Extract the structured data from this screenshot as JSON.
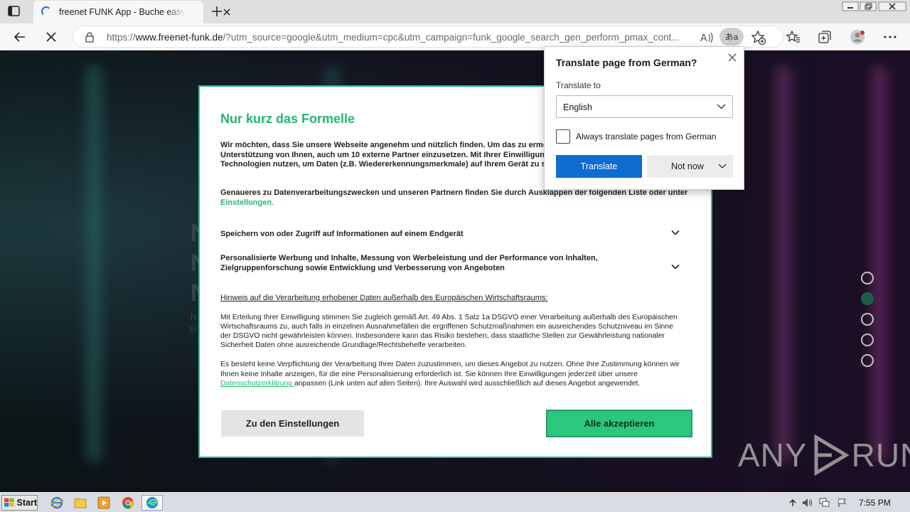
{
  "browser": {
    "tab": {
      "title": "freenet FUNK App - Buche easy und flexibel"
    },
    "url": {
      "prefix": "https://",
      "host": "www.freenet-funk.de",
      "path": "/?utm_source=google&utm_medium=cpc&utm_campaign=funk_google_search_gen_perform_pmax_cont..."
    },
    "translate_icon_text": "あa"
  },
  "consent": {
    "title": "Nur kurz das Formelle",
    "intro": "Wir möchten, dass Sie unsere Webseite angenehm und nützlich finden. Um das zu ermöglichen, benötigen wir ein wenig Unterstützung von Ihnen, auch um 10 externe Partner einzusetzen. Mit Ihrer Einwilligung dürfen wir Cookies und andere Technologien nutzen, um Daten (z.B. Wiedererkennungsmerkmale) auf Ihrem Gerät zu speichern und zu verarbeiten.",
    "details_text": "Genaueres zu Datenverarbeitungszwecken und unseren Partnern finden Sie durch Ausklappen der folgenden Liste oder unter ",
    "details_link": "Einstellungen",
    "details_end": ".",
    "accordion": [
      {
        "label": "Speichern von oder Zugriff auf Informationen auf einem Endgerät"
      },
      {
        "label": "Personalisierte Werbung und Inhalte, Messung von Werbeleistung und der Performance von Inhalten, Zielgruppenforschung sowie Entwicklung und Verbesserung von Angeboten"
      }
    ],
    "notice_heading": "Hinweis auf die Verarbeitung erhobener Daten außerhalb des Europäischen Wirtschaftsraums: ",
    "notice_text": "Mit Erteilung Ihrer Einwilligung stimmen Sie zugleich gemäß Art. 49 Abs. 1 Satz 1a DSGVO einer Verarbeitung außerhalb des Europäischen Wirtschaftsraums zu, auch falls in einzelnen Ausnahmefällen die ergriffenen Schutzmaßnahmen ein ausreichendes Schutzniveau im Sinne der DSGVO nicht gewährleisten können. Insbesondere kann das Risiko bestehen, dass staatliche Stellen zur Gewährleistung nationaler Sicherheit Daten ohne ausreichende Grundlage/Rechtsbehelfe verarbeiten.",
    "voluntary_text": "Es besteht keine Verpflichtung der Verarbeitung Ihrer Daten zuzustimmen, um dieses Angebot zu nutzen. Ohne Ihre Zustimmung können wir Ihnen keine Inhalte anzeigen, für die eine Personalisierung erforderlich ist. Sie können Ihre Einwilligungen jederzeit über unsere ",
    "privacy_link": "Datenschutzerklärung ",
    "voluntary_end": "anpassen (Link unten auf allen Seiten). Ihre Auswahl wird ausschließlich auf dieses Angebot angewendet.",
    "btn_settings": "Zu den Einstellungen",
    "btn_accept": "Alle akzeptieren"
  },
  "translate_popup": {
    "title": "Translate page from  German?",
    "label": "Translate to",
    "selected_language": "English",
    "checkbox_label": "Always translate pages from German",
    "btn_translate": "Translate",
    "btn_not_now": "Not now"
  },
  "page": {
    "bg_letters": [
      "N",
      "N",
      "N"
    ],
    "bg_fragments": [
      "N",
      "Ei"
    ],
    "slider_dots": {
      "count": 5,
      "active_index": 1
    }
  },
  "watermark": {
    "left": "ANY",
    "right": "RUN"
  },
  "taskbar": {
    "start_label": "Start",
    "apps": [
      "ie-icon",
      "explorer-icon",
      "media-player-icon",
      "chrome-icon",
      "edge-icon"
    ],
    "clock": "7:55 PM"
  },
  "colors": {
    "accent_green": "#25b773",
    "accept_button": "#2bc77d",
    "translate_blue": "#0f6cd0"
  }
}
